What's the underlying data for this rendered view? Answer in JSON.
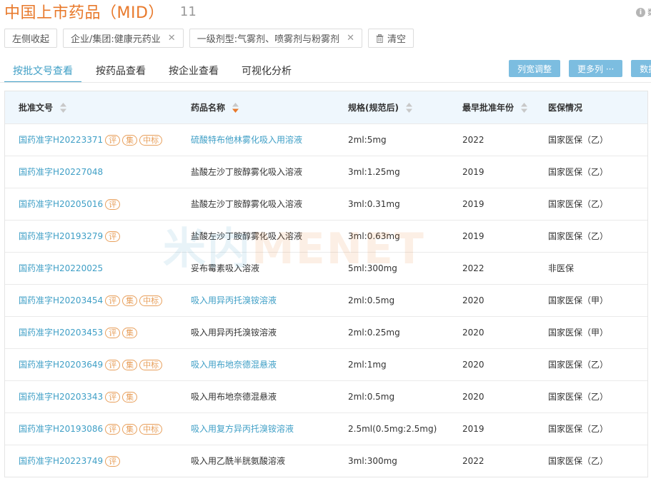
{
  "header": {
    "title": "中国上市药品（MID）",
    "count": "11",
    "help_label": "数"
  },
  "filters": {
    "collapse_label": "左侧收起",
    "chips": [
      {
        "label": "企业/集团:健康元药业"
      },
      {
        "label": "一级剂型:气雾剂、喷雾剂与粉雾剂"
      }
    ],
    "clear_label": "清空"
  },
  "tabs": [
    {
      "label": "按批文号查看",
      "active": true
    },
    {
      "label": "按药品查看"
    },
    {
      "label": "按企业查看"
    },
    {
      "label": "可视化分析"
    }
  ],
  "actions": {
    "col_width_label": "列宽调整",
    "more_cols_label": "更多列 ···",
    "data_label": "数据"
  },
  "columns": {
    "approval_no": "批准文号",
    "drug_name": "药品名称",
    "spec": "规格(规范后)",
    "year": "最早批准年份",
    "insurance": "医保情况"
  },
  "watermark": {
    "part1": "米内",
    "part2": "MENET"
  },
  "rows": [
    {
      "approval_no": "国药准字H20223371",
      "tags": [
        "评",
        "集",
        "中标"
      ],
      "drug_name": "硫酸特布他林雾化吸入用溶液",
      "drug_link": true,
      "spec": "2ml:5mg",
      "year": "2022",
      "insurance": "国家医保（乙）"
    },
    {
      "approval_no": "国药准字H20227048",
      "tags": [],
      "drug_name": "盐酸左沙丁胺醇雾化吸入溶液",
      "drug_link": false,
      "spec": "3ml:1.25mg",
      "year": "2019",
      "insurance": "国家医保（乙）"
    },
    {
      "approval_no": "国药准字H20205016",
      "tags": [
        "评"
      ],
      "drug_name": "盐酸左沙丁胺醇雾化吸入溶液",
      "drug_link": false,
      "spec": "3ml:0.31mg",
      "year": "2019",
      "insurance": "国家医保（乙）"
    },
    {
      "approval_no": "国药准字H20193279",
      "tags": [
        "评"
      ],
      "drug_name": "盐酸左沙丁胺醇雾化吸入溶液",
      "drug_link": false,
      "spec": "3ml:0.63mg",
      "year": "2019",
      "insurance": "国家医保（乙）"
    },
    {
      "approval_no": "国药准字H20220025",
      "tags": [],
      "drug_name": "妥布霉素吸入溶液",
      "drug_link": false,
      "spec": "5ml:300mg",
      "year": "2022",
      "insurance": "非医保"
    },
    {
      "approval_no": "国药准字H20203454",
      "tags": [
        "评",
        "集",
        "中标"
      ],
      "drug_name": "吸入用异丙托溴铵溶液",
      "drug_link": true,
      "spec": "2ml:0.5mg",
      "year": "2020",
      "insurance": "国家医保（甲）"
    },
    {
      "approval_no": "国药准字H20203453",
      "tags": [
        "评",
        "集"
      ],
      "drug_name": "吸入用异丙托溴铵溶液",
      "drug_link": false,
      "spec": "2ml:0.25mg",
      "year": "2020",
      "insurance": "国家医保（甲）"
    },
    {
      "approval_no": "国药准字H20203649",
      "tags": [
        "评",
        "集",
        "中标"
      ],
      "drug_name": "吸入用布地奈德混悬液",
      "drug_link": true,
      "spec": "2ml:1mg",
      "year": "2020",
      "insurance": "国家医保（乙）"
    },
    {
      "approval_no": "国药准字H20203343",
      "tags": [
        "评",
        "集"
      ],
      "drug_name": "吸入用布地奈德混悬液",
      "drug_link": false,
      "spec": "2ml:0.5mg",
      "year": "2020",
      "insurance": "国家医保（乙）"
    },
    {
      "approval_no": "国药准字H20193086",
      "tags": [
        "评",
        "集",
        "中标"
      ],
      "drug_name": "吸入用复方异丙托溴铵溶液",
      "drug_link": true,
      "spec": "2.5ml(0.5mg:2.5mg)",
      "year": "2019",
      "insurance": "国家医保（乙）"
    },
    {
      "approval_no": "国药准字H20223749",
      "tags": [
        "评"
      ],
      "drug_name": "吸入用乙酰半胱氨酸溶液",
      "drug_link": false,
      "spec": "3ml:300mg",
      "year": "2022",
      "insurance": "国家医保（乙）"
    }
  ]
}
